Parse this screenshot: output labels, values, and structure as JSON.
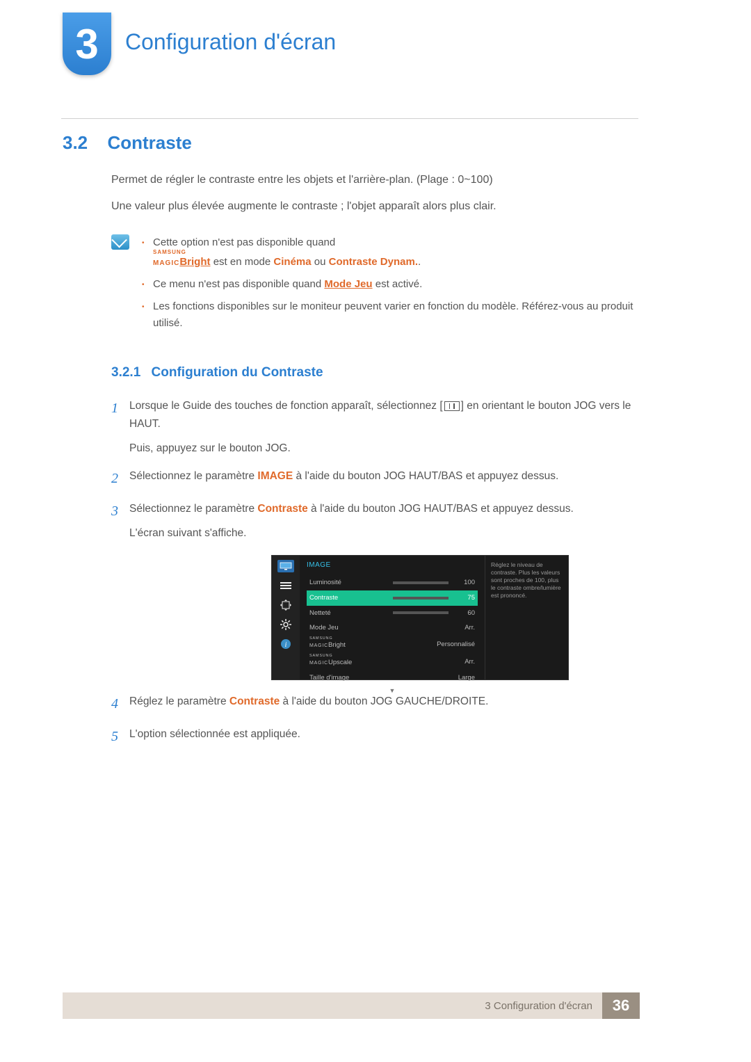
{
  "chapter": {
    "number": "3",
    "title": "Configuration d'écran"
  },
  "section": {
    "number": "3.2",
    "title": "Contraste",
    "para1": "Permet de régler le contraste entre les objets et l'arrière-plan. (Plage : 0~100)",
    "para2": "Une valeur plus élevée augmente le contraste ; l'objet apparaît alors plus clair."
  },
  "notes": {
    "item1_a": "Cette option n'est pas disponible quand ",
    "item1_magic_top": "SAMSUNG",
    "item1_magic_bottom": "MAGIC",
    "item1_bright": "Bright",
    "item1_b": " est en mode ",
    "item1_cinema": "Cinéma",
    "item1_c": " ou ",
    "item1_dynam": "Contraste Dynam.",
    "item1_d": ".",
    "item2_a": "Ce menu n'est pas disponible quand ",
    "item2_mode": "Mode Jeu",
    "item2_b": " est activé.",
    "item3": "Les fonctions disponibles sur le moniteur peuvent varier en fonction du modèle. Référez-vous au produit utilisé."
  },
  "subsection": {
    "number": "3.2.1",
    "title": "Configuration du Contraste"
  },
  "steps": {
    "s1a": "Lorsque le Guide des touches de fonction apparaît, sélectionnez [",
    "s1b": "] en orientant le bouton JOG vers le HAUT.",
    "s1c": "Puis, appuyez sur le bouton JOG.",
    "s2a": "Sélectionnez le paramètre ",
    "s2_image": "IMAGE",
    "s2b": " à l'aide du bouton JOG HAUT/BAS et appuyez dessus.",
    "s3a": "Sélectionnez le paramètre ",
    "s3_contraste": "Contraste",
    "s3b": " à l'aide du bouton JOG HAUT/BAS et appuyez dessus.",
    "s3c": "L'écran suivant s'affiche.",
    "s4a": "Réglez le paramètre ",
    "s4_contraste": "Contraste",
    "s4b": " à l'aide du bouton JOG GAUCHE/DROITE.",
    "s5": "L'option sélectionnée est appliquée."
  },
  "osd": {
    "title": "IMAGE",
    "rows": {
      "luminosite": {
        "label": "Luminosité",
        "value": "100",
        "fill": 100
      },
      "contraste": {
        "label": "Contraste",
        "value": "75",
        "fill": 75
      },
      "nettete": {
        "label": "Netteté",
        "value": "60",
        "fill": 60
      },
      "modejeu": {
        "label": "Mode Jeu",
        "value": "Arr."
      },
      "bright": {
        "label_top": "SAMSUNG",
        "label_bottom": "MAGIC",
        "label_suffix": "Bright",
        "value": "Personnalisé"
      },
      "upscale": {
        "label_top": "SAMSUNG",
        "label_bottom": "MAGIC",
        "label_suffix": "Upscale",
        "value": "Arr."
      },
      "taille": {
        "label": "Taille d'image",
        "value": "Large"
      }
    },
    "help": "Réglez le niveau de contraste. Plus les valeurs sont proches de 100, plus le contraste ombre/lumière est prononcé."
  },
  "footer": {
    "text": "3 Configuration d'écran",
    "page": "36"
  }
}
